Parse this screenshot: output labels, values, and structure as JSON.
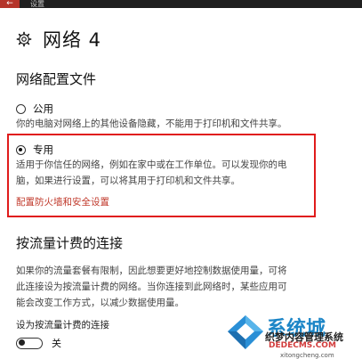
{
  "window": {
    "title": "设置",
    "back_glyph": "←"
  },
  "header": {
    "title": "网络 4",
    "icon": "gear-icon"
  },
  "profile": {
    "heading": "网络配置文件",
    "public": {
      "label": "公用",
      "description": "你的电脑对网络上的其他设备隐藏，不能用于打印机和文件共享。"
    },
    "private": {
      "label": "专用",
      "description_line1": "适用于你信任的网络，例如在家中或在工作单位。可以发现你的电",
      "description_line2": "脑，如果进行设置，可以将其用于打印机和文件共享。",
      "selected": true
    },
    "firewall_link": "配置防火墙和安全设置"
  },
  "metered": {
    "heading": "按流量计费的连接",
    "description_line1": "如果你的流量套餐有限制，因此想要更好地控制数据使用量，可将",
    "description_line2": "此连接设为按流量计费的网络。当你连接到此网络时，某些应用可",
    "description_line3": "能会改变工作方式，以减少数据使用量。",
    "toggle_label": "设为按流量计费的连接",
    "toggle_state": "关",
    "toggle_on": false
  },
  "watermark": {
    "line1": "系统城",
    "line2": "织梦内容管理系统",
    "line3": "DEDECMS.COM",
    "line4": "xitongcheng.com"
  },
  "colors": {
    "accent_red": "#e01b1b",
    "link_red": "#c0392b",
    "back_button": "#b5342a"
  }
}
